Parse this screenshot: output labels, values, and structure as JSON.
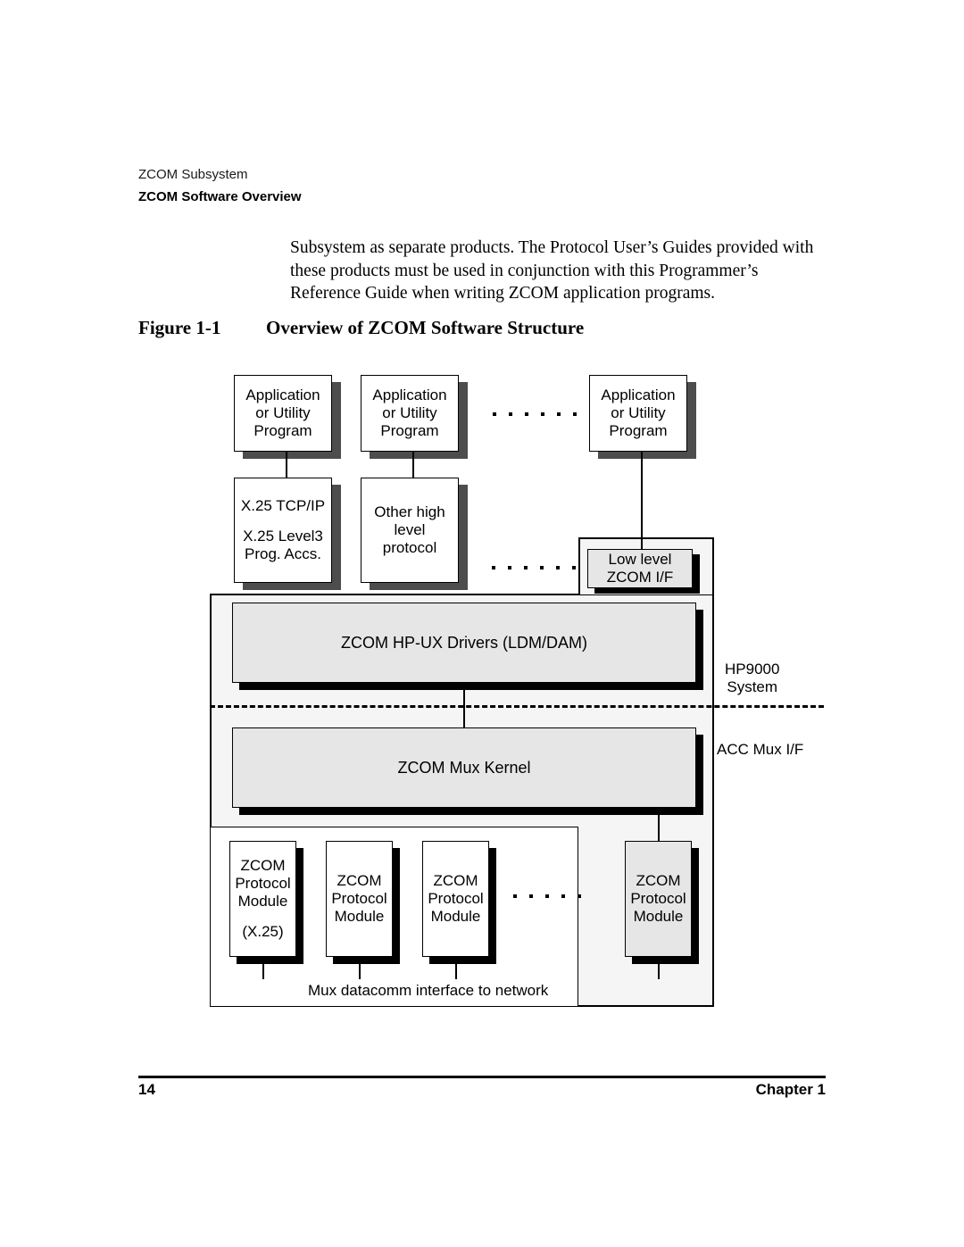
{
  "header": {
    "subsystem": "ZCOM Subsystem",
    "section": "ZCOM Software Overview"
  },
  "body": {
    "paragraph": "Subsystem as separate products. The Protocol User’s Guides provided with these products must be used in conjunction with this Programmer’s Reference Guide when writing ZCOM application programs."
  },
  "figure": {
    "number": "Figure 1-1",
    "title": "Overview of ZCOM Software Structure",
    "app_boxes": [
      {
        "label": "Application\nor Utility\nProgram"
      },
      {
        "label": "Application\nor Utility\nProgram"
      },
      {
        "label": "Application\nor Utility\nProgram"
      }
    ],
    "protocol_layer": {
      "x25_box": "X.25 TCP/IP\n\nX.25 Level3\nProg. Accs.",
      "x25_line1": "X.25 TCP/IP",
      "x25_line2": "X.25 Level3",
      "x25_line3": "Prog. Accs.",
      "other_box": "Other high\nlevel\nprotocol",
      "low_level_box": "Low level\nZCOM I/F"
    },
    "bands": {
      "drivers": "ZCOM HP-UX Drivers (LDM/DAM)",
      "mux_kernel": "ZCOM Mux Kernel"
    },
    "side_labels": {
      "hp9000": "HP9000\nSystem",
      "hp9000_line1": "HP9000",
      "hp9000_line2": "System",
      "acc_mux": "ACC Mux I/F"
    },
    "protocol_modules": [
      {
        "label": "ZCOM\nProtocol\nModule\n\n(X.25)",
        "line1": "ZCOM",
        "line2": "Protocol",
        "line3": "Module",
        "line4": "(X.25)",
        "style": "white"
      },
      {
        "label": "ZCOM\nProtocol\nModule",
        "line1": "ZCOM",
        "line2": "Protocol",
        "line3": "Module",
        "line4": "",
        "style": "white"
      },
      {
        "label": "ZCOM\nProtocol\nModule",
        "line1": "ZCOM",
        "line2": "Protocol",
        "line3": "Module",
        "line4": "",
        "style": "white"
      },
      {
        "label": "ZCOM\nProtocol\nModule",
        "line1": "ZCOM",
        "line2": "Protocol",
        "line3": "Module",
        "line4": "",
        "style": "gray"
      }
    ],
    "network_caption": "Mux datacomm interface to network",
    "colors": {
      "box_fill": "#ffffff",
      "gray_fill": "#e6e6e6",
      "frame_fill": "#f5f5f5",
      "shadow_gray": "#4d4d4d",
      "shadow_black": "#000000",
      "stroke": "#000000"
    }
  },
  "footer": {
    "page": "14",
    "chapter": "Chapter 1"
  }
}
